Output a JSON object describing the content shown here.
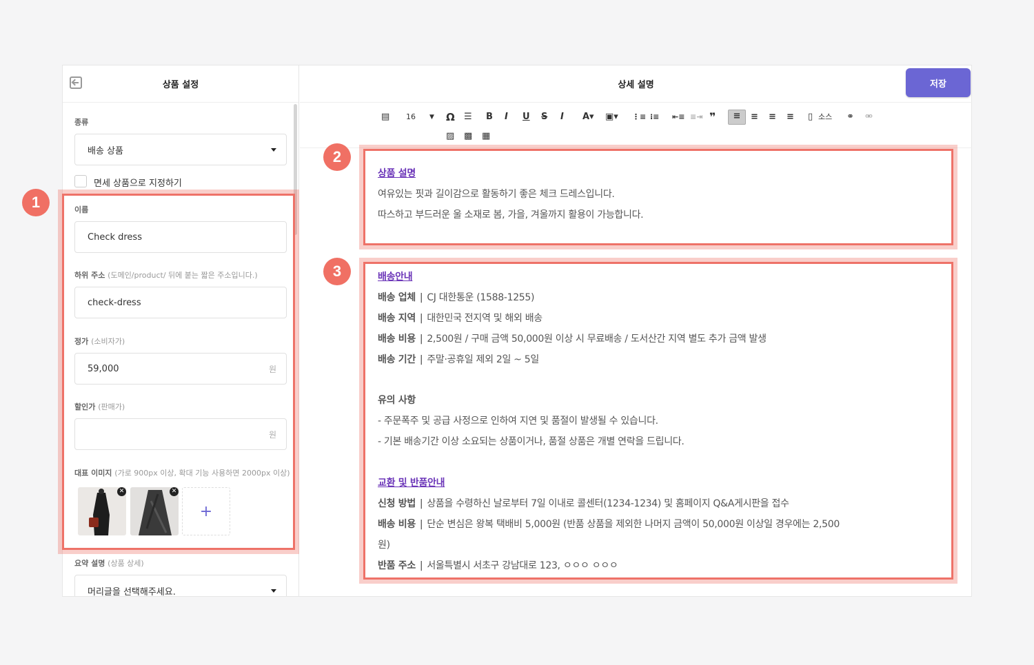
{
  "left_panel": {
    "title": "상품 설정",
    "type_label": "종류",
    "type_value": "배송 상품",
    "tax_free_label": "면세 상품으로 지정하기",
    "name_label": "이름",
    "name_value": "Check dress",
    "slug_label": "하위 주소",
    "slug_sub": "(도메인/product/ 뒤에 붙는 짧은 주소입니다.)",
    "slug_value": "check-dress",
    "price_label": "정가",
    "price_sub": "(소비자가)",
    "price_value": "59,000",
    "price_unit": "원",
    "discount_label": "할인가",
    "discount_sub": "(판매가)",
    "discount_value": "",
    "discount_unit": "원",
    "image_label": "대표 이미지",
    "image_sub": "(가로 900px 이상, 확대 기능 사용하면 2000px 이상)",
    "summary_label": "요약 설명",
    "summary_sub": "(상품 상세)",
    "summary_value": "머리글을 선택해주세요.",
    "add_symbol": "+",
    "remove_symbol": "✕"
  },
  "right_panel": {
    "title": "상세 설명",
    "save_label": "저장",
    "font_size": "16",
    "source_label": "소스"
  },
  "badges": [
    "1",
    "2",
    "3"
  ],
  "content": {
    "desc_heading": "상품 설명",
    "desc_lines": [
      "여유있는 핏과 길이감으로 활동하기 좋은 체크 드레스입니다.",
      "따스하고 부드러운 울 소재로 봄, 가을, 겨울까지 활용이 가능합니다."
    ],
    "ship_heading": "배송안내",
    "ship_rows": [
      {
        "k": "배송 업체",
        "v": "CJ 대한통운 (1588-1255)"
      },
      {
        "k": "배송 지역",
        "v": "대한민국 전지역 및 해외 배송"
      },
      {
        "k": "배송 비용",
        "v": "2,500원 / 구매 금액 50,000원 이상 시 무료배송 / 도서산간 지역 별도 추가 금액 발생"
      },
      {
        "k": "배송 기간",
        "v": "주말·공휴일 제외 2일 ~ 5일"
      }
    ],
    "sep": "|",
    "notice_heading": "유의 사항",
    "notice_lines": [
      "- 주문폭주 및 공급 사정으로 인하여 지연 및 품절이 발생될 수 있습니다.",
      "- 기본 배송기간 이상 소요되는 상품이거나, 품절 상품은 개별 연락을 드립니다."
    ],
    "return_heading": "교환 및 반품안내",
    "return_rows": [
      {
        "k": "신청 방법",
        "v": "상품을 수령하신 날로부터 7일 이내로 콜센터(1234-1234) 및 홈페이지 Q&A게시판을  접수"
      },
      {
        "k": "배송 비용",
        "v": "단순 변심은 왕복 택배비 5,000원 (반품 상품을 제외한 나머지 금액이 50,000원 이상일 경우에는 2,500"
      }
    ],
    "return_wrap": "원)",
    "return_addr": {
      "k": "반품 주소",
      "v": "서울특별시 서초구 강남대로 123, ㅇㅇㅇ ㅇㅇㅇ"
    }
  },
  "colors": {
    "accent": "#6b66d4",
    "highlight": "#ee7268",
    "badge": "#f07064",
    "link": "#6b35b8"
  }
}
